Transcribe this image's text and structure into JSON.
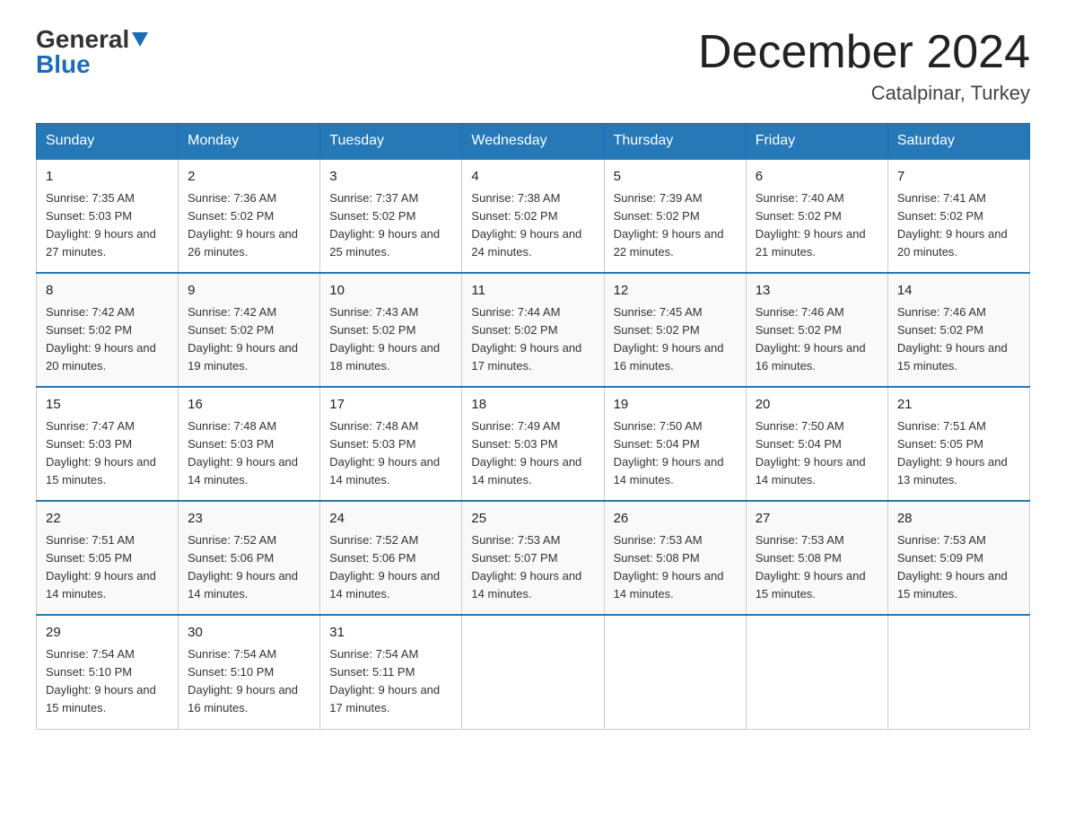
{
  "logo": {
    "general": "General",
    "blue": "Blue"
  },
  "title": {
    "month_year": "December 2024",
    "location": "Catalpinar, Turkey"
  },
  "days_header": [
    "Sunday",
    "Monday",
    "Tuesday",
    "Wednesday",
    "Thursday",
    "Friday",
    "Saturday"
  ],
  "weeks": [
    [
      {
        "day": "1",
        "sunrise": "7:35 AM",
        "sunset": "5:03 PM",
        "daylight": "9 hours and 27 minutes."
      },
      {
        "day": "2",
        "sunrise": "7:36 AM",
        "sunset": "5:02 PM",
        "daylight": "9 hours and 26 minutes."
      },
      {
        "day": "3",
        "sunrise": "7:37 AM",
        "sunset": "5:02 PM",
        "daylight": "9 hours and 25 minutes."
      },
      {
        "day": "4",
        "sunrise": "7:38 AM",
        "sunset": "5:02 PM",
        "daylight": "9 hours and 24 minutes."
      },
      {
        "day": "5",
        "sunrise": "7:39 AM",
        "sunset": "5:02 PM",
        "daylight": "9 hours and 22 minutes."
      },
      {
        "day": "6",
        "sunrise": "7:40 AM",
        "sunset": "5:02 PM",
        "daylight": "9 hours and 21 minutes."
      },
      {
        "day": "7",
        "sunrise": "7:41 AM",
        "sunset": "5:02 PM",
        "daylight": "9 hours and 20 minutes."
      }
    ],
    [
      {
        "day": "8",
        "sunrise": "7:42 AM",
        "sunset": "5:02 PM",
        "daylight": "9 hours and 20 minutes."
      },
      {
        "day": "9",
        "sunrise": "7:42 AM",
        "sunset": "5:02 PM",
        "daylight": "9 hours and 19 minutes."
      },
      {
        "day": "10",
        "sunrise": "7:43 AM",
        "sunset": "5:02 PM",
        "daylight": "9 hours and 18 minutes."
      },
      {
        "day": "11",
        "sunrise": "7:44 AM",
        "sunset": "5:02 PM",
        "daylight": "9 hours and 17 minutes."
      },
      {
        "day": "12",
        "sunrise": "7:45 AM",
        "sunset": "5:02 PM",
        "daylight": "9 hours and 16 minutes."
      },
      {
        "day": "13",
        "sunrise": "7:46 AM",
        "sunset": "5:02 PM",
        "daylight": "9 hours and 16 minutes."
      },
      {
        "day": "14",
        "sunrise": "7:46 AM",
        "sunset": "5:02 PM",
        "daylight": "9 hours and 15 minutes."
      }
    ],
    [
      {
        "day": "15",
        "sunrise": "7:47 AM",
        "sunset": "5:03 PM",
        "daylight": "9 hours and 15 minutes."
      },
      {
        "day": "16",
        "sunrise": "7:48 AM",
        "sunset": "5:03 PM",
        "daylight": "9 hours and 14 minutes."
      },
      {
        "day": "17",
        "sunrise": "7:48 AM",
        "sunset": "5:03 PM",
        "daylight": "9 hours and 14 minutes."
      },
      {
        "day": "18",
        "sunrise": "7:49 AM",
        "sunset": "5:03 PM",
        "daylight": "9 hours and 14 minutes."
      },
      {
        "day": "19",
        "sunrise": "7:50 AM",
        "sunset": "5:04 PM",
        "daylight": "9 hours and 14 minutes."
      },
      {
        "day": "20",
        "sunrise": "7:50 AM",
        "sunset": "5:04 PM",
        "daylight": "9 hours and 14 minutes."
      },
      {
        "day": "21",
        "sunrise": "7:51 AM",
        "sunset": "5:05 PM",
        "daylight": "9 hours and 13 minutes."
      }
    ],
    [
      {
        "day": "22",
        "sunrise": "7:51 AM",
        "sunset": "5:05 PM",
        "daylight": "9 hours and 14 minutes."
      },
      {
        "day": "23",
        "sunrise": "7:52 AM",
        "sunset": "5:06 PM",
        "daylight": "9 hours and 14 minutes."
      },
      {
        "day": "24",
        "sunrise": "7:52 AM",
        "sunset": "5:06 PM",
        "daylight": "9 hours and 14 minutes."
      },
      {
        "day": "25",
        "sunrise": "7:53 AM",
        "sunset": "5:07 PM",
        "daylight": "9 hours and 14 minutes."
      },
      {
        "day": "26",
        "sunrise": "7:53 AM",
        "sunset": "5:08 PM",
        "daylight": "9 hours and 14 minutes."
      },
      {
        "day": "27",
        "sunrise": "7:53 AM",
        "sunset": "5:08 PM",
        "daylight": "9 hours and 15 minutes."
      },
      {
        "day": "28",
        "sunrise": "7:53 AM",
        "sunset": "5:09 PM",
        "daylight": "9 hours and 15 minutes."
      }
    ],
    [
      {
        "day": "29",
        "sunrise": "7:54 AM",
        "sunset": "5:10 PM",
        "daylight": "9 hours and 15 minutes."
      },
      {
        "day": "30",
        "sunrise": "7:54 AM",
        "sunset": "5:10 PM",
        "daylight": "9 hours and 16 minutes."
      },
      {
        "day": "31",
        "sunrise": "7:54 AM",
        "sunset": "5:11 PM",
        "daylight": "9 hours and 17 minutes."
      },
      null,
      null,
      null,
      null
    ]
  ],
  "labels": {
    "sunrise": "Sunrise:",
    "sunset": "Sunset:",
    "daylight": "Daylight:"
  }
}
